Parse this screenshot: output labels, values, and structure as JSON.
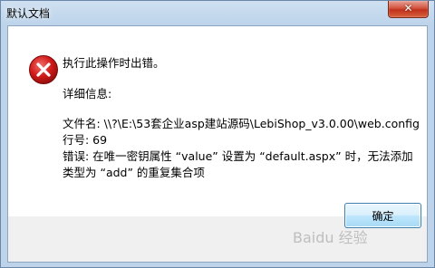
{
  "window": {
    "title": "默认文档",
    "close_glyph": "✕"
  },
  "dialog": {
    "icon": "error-icon",
    "heading": "执行此操作时出错。",
    "details_label": "详细信息:",
    "lines": [
      "文件名: \\\\?\\E:\\53套企业asp建站源码\\LebiShop_v3.0.00\\web.config",
      "行号: 69",
      "错误: 在唯一密钥属性 “value” 设置为 “default.aspx” 时，无法添加",
      "类型为 “add” 的重复集合项"
    ],
    "ok_label": "确定"
  },
  "watermark": "Baidu 经验",
  "colors": {
    "title_bar": "#bcd3ea",
    "close_button": "#c1301a",
    "error_red": "#d21a1a",
    "ok_button": "#bee6fd"
  }
}
